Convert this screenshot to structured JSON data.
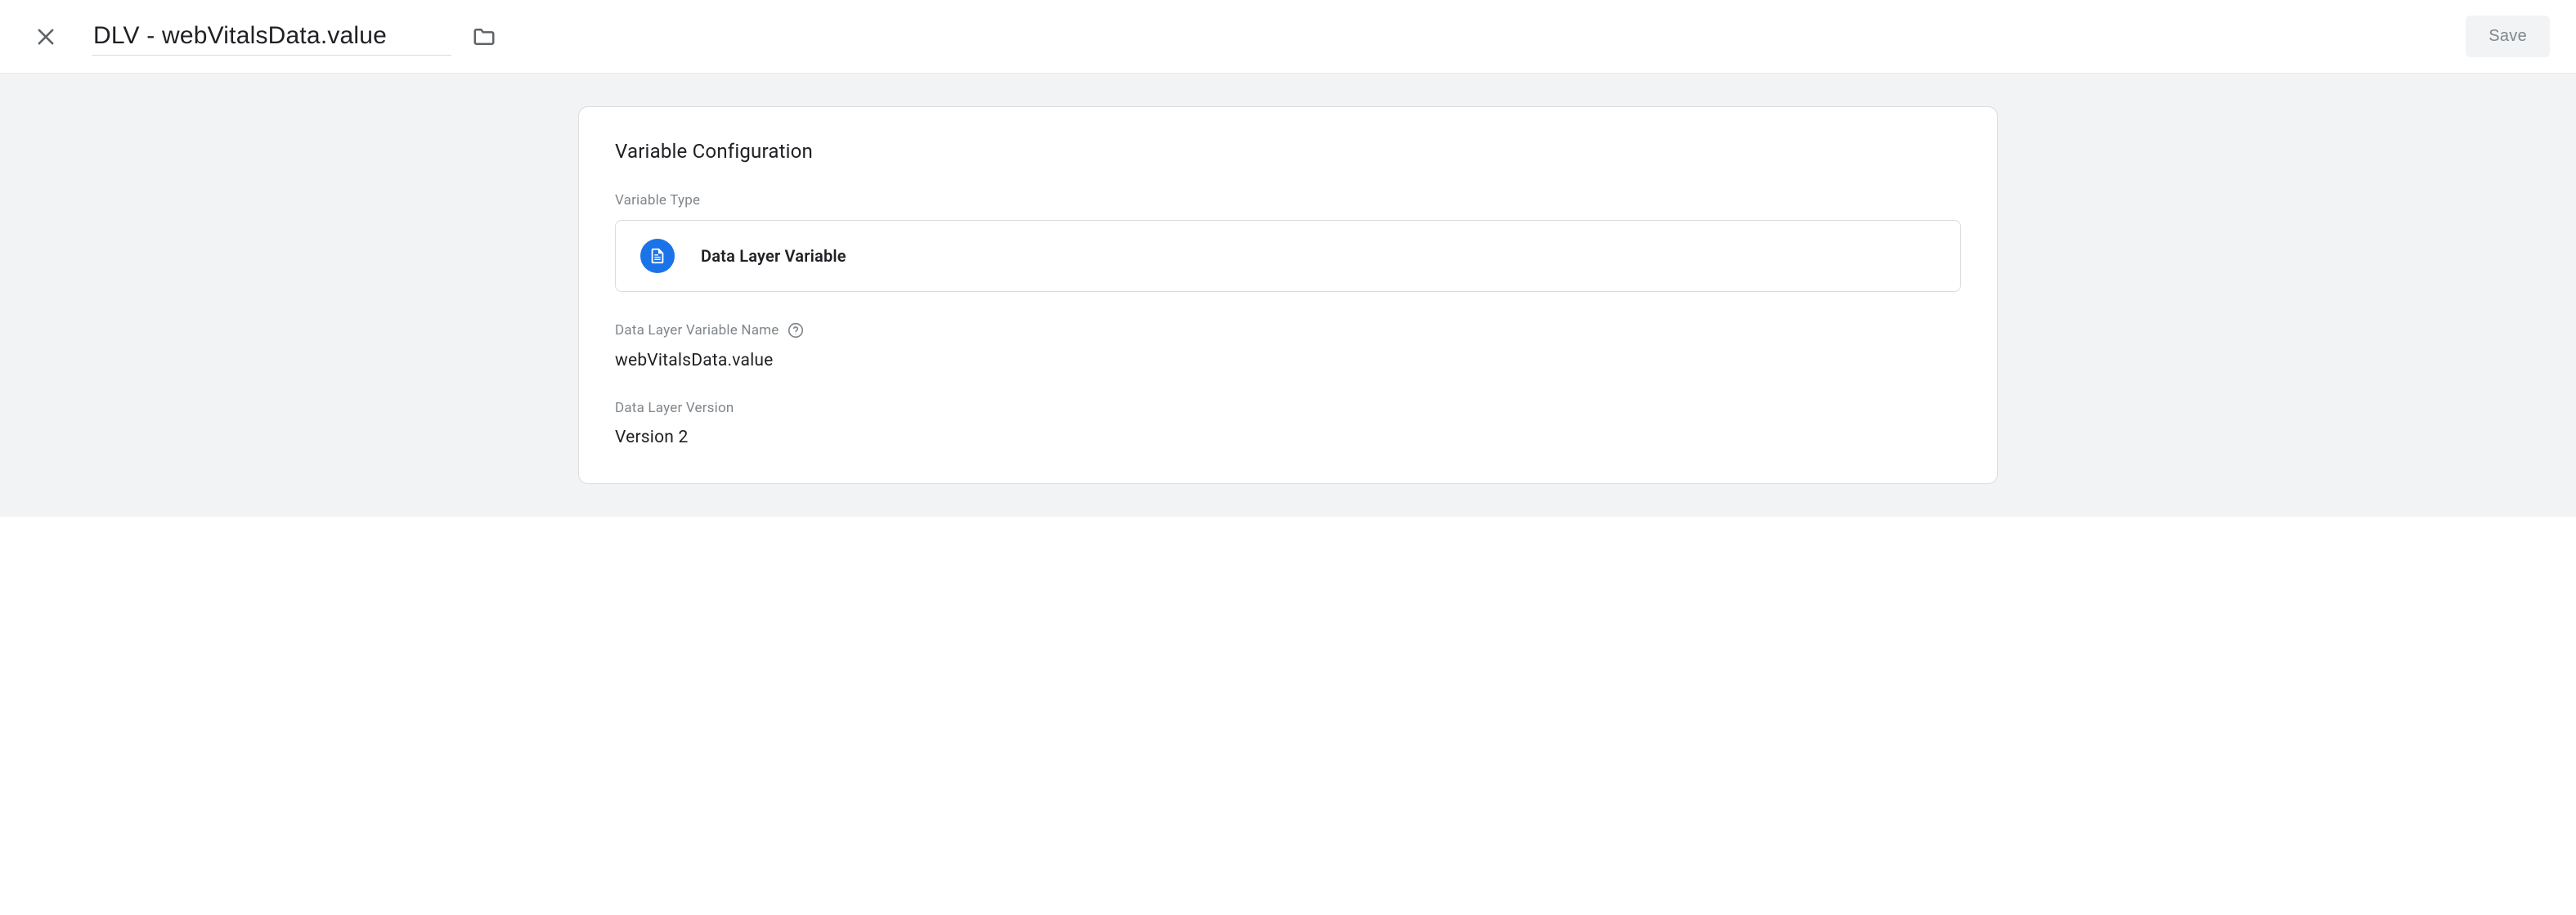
{
  "header": {
    "title": "DLV - webVitalsData.value",
    "save_label": "Save"
  },
  "config": {
    "card_title": "Variable Configuration",
    "variable_type_label": "Variable Type",
    "variable_type_value": "Data Layer Variable",
    "variable_name_label": "Data Layer Variable Name",
    "variable_name_value": "webVitalsData.value",
    "version_label": "Data Layer Version",
    "version_value": "Version 2"
  }
}
